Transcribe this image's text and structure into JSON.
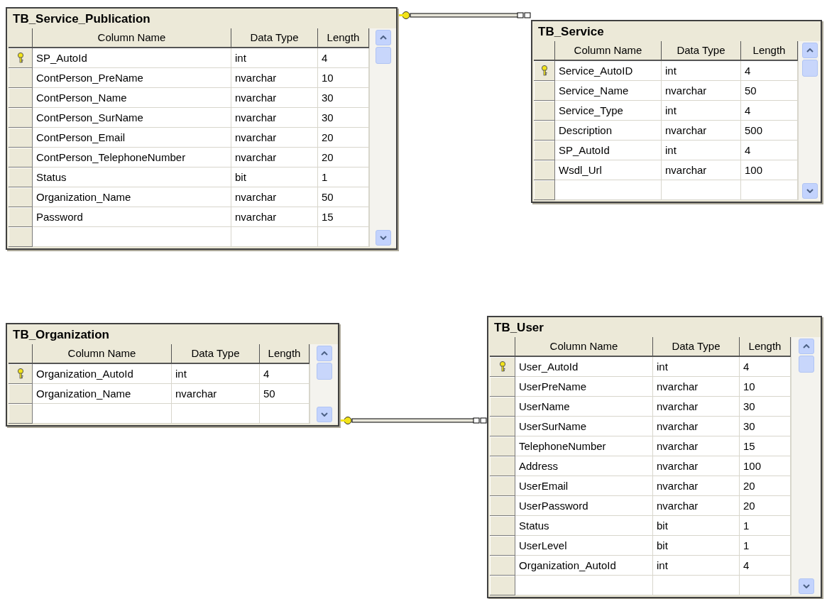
{
  "tables": [
    {
      "title": "TB_Service_Publication",
      "columns": [
        "Column Name",
        "Data Type",
        "Length"
      ],
      "rows": [
        {
          "primary_key": true,
          "name": "SP_AutoId",
          "type": "int",
          "length": "4"
        },
        {
          "primary_key": false,
          "name": "ContPerson_PreName",
          "type": "nvarchar",
          "length": "10"
        },
        {
          "primary_key": false,
          "name": "ContPerson_Name",
          "type": "nvarchar",
          "length": "30"
        },
        {
          "primary_key": false,
          "name": "ContPerson_SurName",
          "type": "nvarchar",
          "length": "30"
        },
        {
          "primary_key": false,
          "name": "ContPerson_Email",
          "type": "nvarchar",
          "length": "20"
        },
        {
          "primary_key": false,
          "name": "ContPerson_TelephoneNumber",
          "type": "nvarchar",
          "length": "20"
        },
        {
          "primary_key": false,
          "name": "Status",
          "type": "bit",
          "length": "1"
        },
        {
          "primary_key": false,
          "name": "Organization_Name",
          "type": "nvarchar",
          "length": "50"
        },
        {
          "primary_key": false,
          "name": "Password",
          "type": "nvarchar",
          "length": "15"
        }
      ]
    },
    {
      "title": "TB_Service",
      "columns": [
        "Column Name",
        "Data Type",
        "Length"
      ],
      "rows": [
        {
          "primary_key": true,
          "name": "Service_AutoID",
          "type": "int",
          "length": "4"
        },
        {
          "primary_key": false,
          "name": "Service_Name",
          "type": "nvarchar",
          "length": "50"
        },
        {
          "primary_key": false,
          "name": "Service_Type",
          "type": "int",
          "length": "4"
        },
        {
          "primary_key": false,
          "name": "Description",
          "type": "nvarchar",
          "length": "500"
        },
        {
          "primary_key": false,
          "name": "SP_AutoId",
          "type": "int",
          "length": "4"
        },
        {
          "primary_key": false,
          "name": "Wsdl_Url",
          "type": "nvarchar",
          "length": "100"
        }
      ]
    },
    {
      "title": "TB_Organization",
      "columns": [
        "Column Name",
        "Data Type",
        "Length"
      ],
      "rows": [
        {
          "primary_key": true,
          "name": "Organization_AutoId",
          "type": "int",
          "length": "4"
        },
        {
          "primary_key": false,
          "name": "Organization_Name",
          "type": "nvarchar",
          "length": "50"
        }
      ]
    },
    {
      "title": "TB_User",
      "columns": [
        "Column Name",
        "Data Type",
        "Length"
      ],
      "rows": [
        {
          "primary_key": true,
          "name": "User_AutoId",
          "type": "int",
          "length": "4"
        },
        {
          "primary_key": false,
          "name": "UserPreName",
          "type": "nvarchar",
          "length": "10"
        },
        {
          "primary_key": false,
          "name": "UserName",
          "type": "nvarchar",
          "length": "30"
        },
        {
          "primary_key": false,
          "name": "UserSurName",
          "type": "nvarchar",
          "length": "30"
        },
        {
          "primary_key": false,
          "name": "TelephoneNumber",
          "type": "nvarchar",
          "length": "15"
        },
        {
          "primary_key": false,
          "name": "Address",
          "type": "nvarchar",
          "length": "100"
        },
        {
          "primary_key": false,
          "name": "UserEmail",
          "type": "nvarchar",
          "length": "20"
        },
        {
          "primary_key": false,
          "name": "UserPassword",
          "type": "nvarchar",
          "length": "20"
        },
        {
          "primary_key": false,
          "name": "Status",
          "type": "bit",
          "length": "1"
        },
        {
          "primary_key": false,
          "name": "UserLevel",
          "type": "bit",
          "length": "1"
        },
        {
          "primary_key": false,
          "name": "Organization_AutoId",
          "type": "int",
          "length": "4"
        }
      ]
    }
  ]
}
